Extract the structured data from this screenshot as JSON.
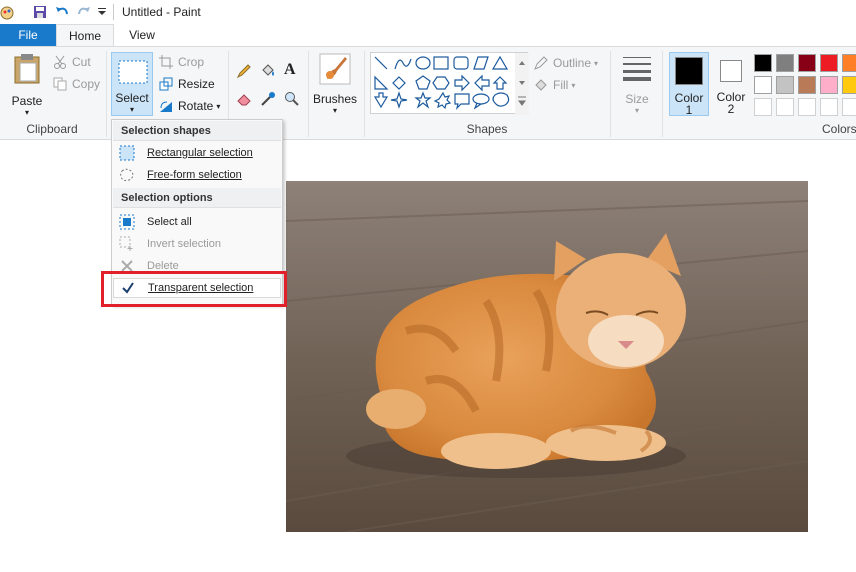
{
  "title": "Untitled - Paint",
  "tabs": {
    "file": "File",
    "home": "Home",
    "view": "View"
  },
  "clipboard": {
    "paste": "Paste",
    "cut": "Cut",
    "copy": "Copy",
    "group": "Clipboard"
  },
  "image_group": {
    "select": "Select",
    "crop": "Crop",
    "resize": "Resize",
    "rotate": "Rotate"
  },
  "tools": {
    "brushes": "Brushes"
  },
  "shapes": {
    "outline": "Outline",
    "fill": "Fill",
    "group": "Shapes"
  },
  "size": {
    "label": "Size"
  },
  "colors": {
    "color1": "Color",
    "color1_num": "1",
    "color2": "Color",
    "color2_num": "2",
    "group": "Colors",
    "palette": [
      "#000000",
      "#7f7f7f",
      "#880015",
      "#ed1c24",
      "#ff7f27",
      "#ffffff",
      "#c3c3c3",
      "#b97a57",
      "#ffaec9",
      "#ffc90e",
      "#ffffff",
      "#ffffff",
      "#ffffff",
      "#ffffff",
      "#ffffff"
    ]
  },
  "menu": {
    "shapes_header": "Selection shapes",
    "rect": "Rectangular selection",
    "free": "Free-form selection",
    "options_header": "Selection options",
    "select_all": "Select all",
    "invert": "Invert selection",
    "delete": "Delete",
    "transparent": "Transparent selection"
  },
  "accent": "#1979ca",
  "highlight": "#e0202a"
}
